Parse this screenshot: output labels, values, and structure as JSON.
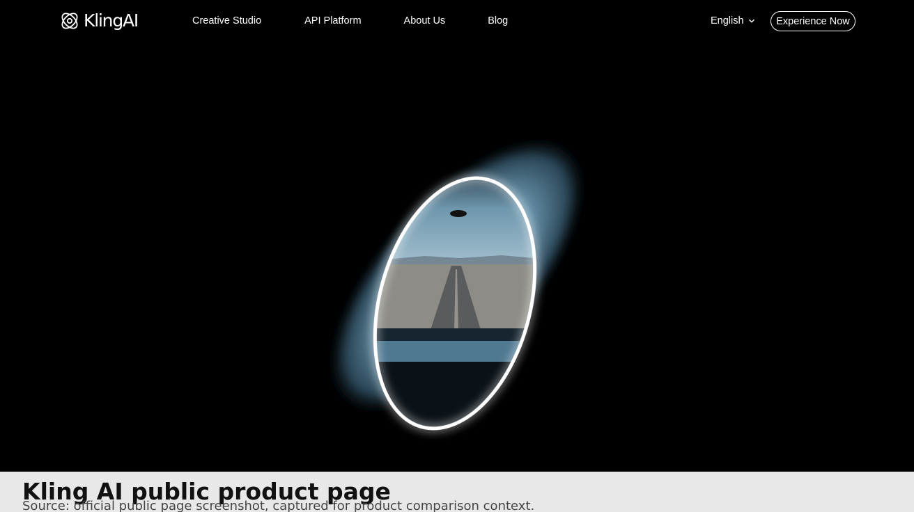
{
  "nav": {
    "logo_text": "KlingAI",
    "logo_icon": "kling-logo-icon",
    "links": [
      "Creative Studio",
      "API Platform",
      "About Us",
      "Blog"
    ],
    "language": "English",
    "language_icon": "chevron-down-icon",
    "cta_label": "Experience Now"
  },
  "hero": {
    "visual": "glowing-ring-portal-desert-road",
    "accent_glow": "#ffffff",
    "portal_tint": "#8fb6cc"
  },
  "caption": {
    "title": "Kling AI public product page",
    "subtitle": "Source: official public page screenshot, captured for product comparison context."
  }
}
